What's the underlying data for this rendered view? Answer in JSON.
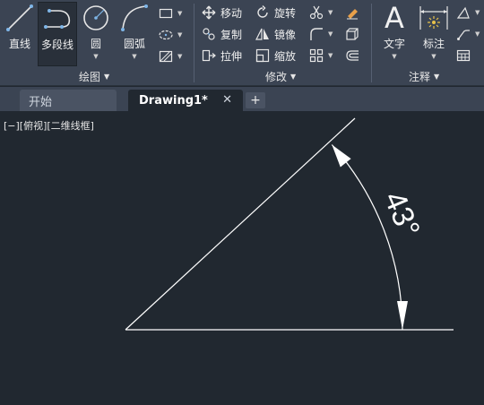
{
  "ribbon": {
    "draw": {
      "title": "绘图",
      "line": "直线",
      "polyline": "多段线",
      "circle": "圆",
      "arc": "圆弧"
    },
    "modify": {
      "title": "修改",
      "move": "移动",
      "rotate": "旋转",
      "copy": "复制",
      "mirror": "镜像",
      "stretch": "拉伸",
      "scale": "缩放"
    },
    "annotation": {
      "title": "注释",
      "text": "文字",
      "dimension": "标注",
      "text_glyph": "A"
    }
  },
  "tabs": {
    "start": "开始",
    "drawing": "Drawing1*",
    "close": "✕",
    "new": "+"
  },
  "viewport": {
    "label": "[−][俯视][二维线框]"
  },
  "drawing": {
    "angle_dimension": "43°"
  },
  "colors": {
    "ribbon_bg": "#3b4453",
    "canvas_bg": "#212830",
    "geometry": "#ffffff",
    "accent_icon": "#7fb6e8"
  }
}
